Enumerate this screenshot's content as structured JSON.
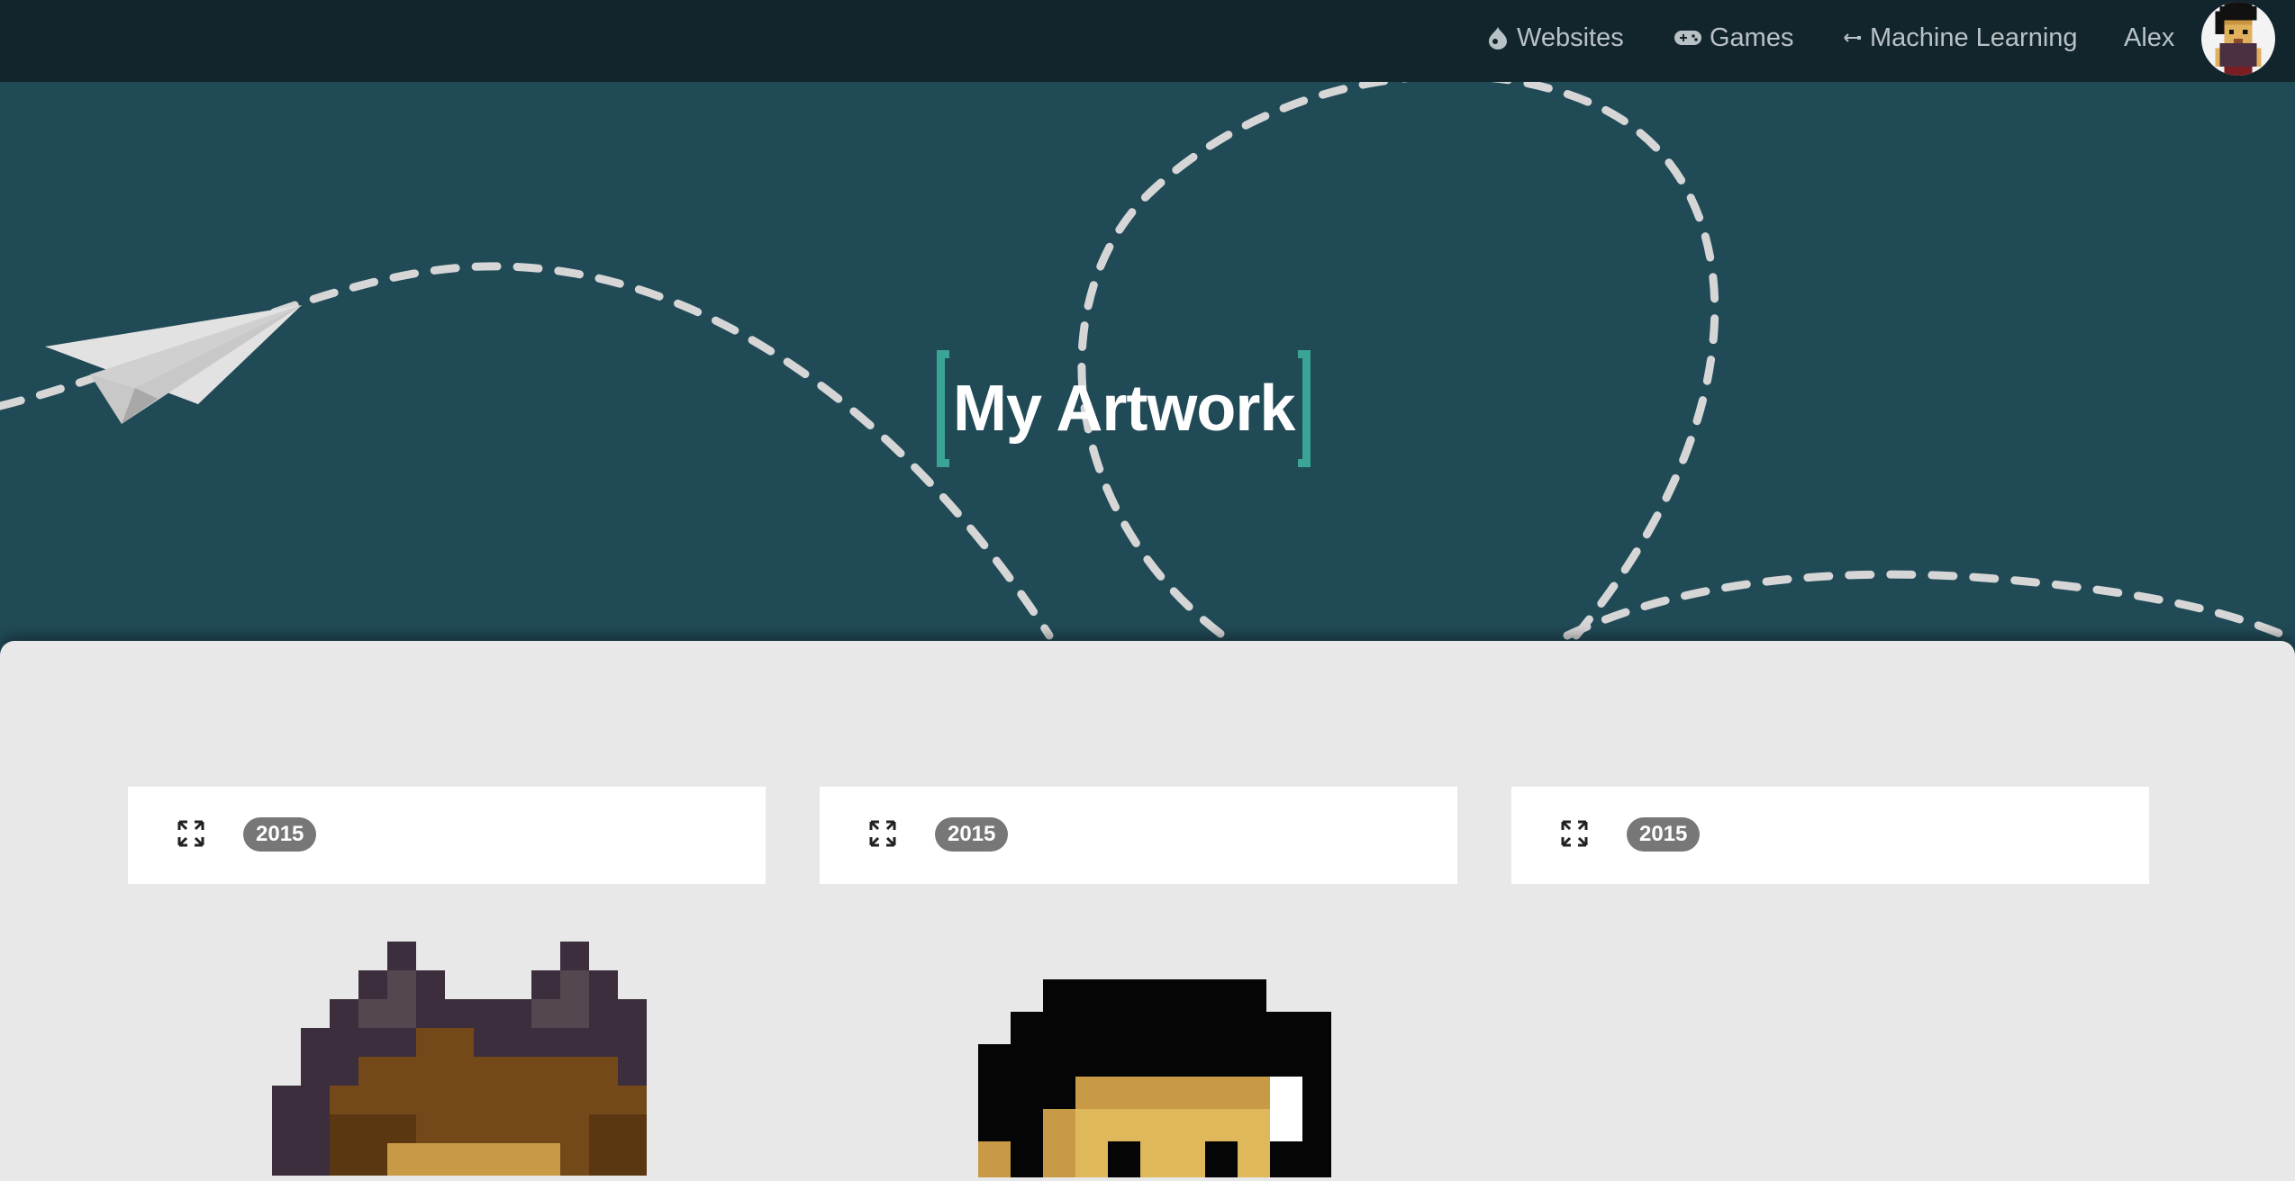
{
  "nav": {
    "items": [
      {
        "label": "Websites",
        "icon": "drupal-drop-icon"
      },
      {
        "label": "Games",
        "icon": "gamepad-icon"
      },
      {
        "label": "Machine Learning",
        "icon": "arrows-icon"
      }
    ],
    "user_name": "Alex"
  },
  "hero": {
    "title": "My Artwork"
  },
  "cards": [
    {
      "year": "2015"
    },
    {
      "year": "2015"
    },
    {
      "year": "2015"
    }
  ],
  "colors": {
    "nav_bg": "#13252c",
    "hero_bg": "#214a57",
    "accent": "#3aa597",
    "content_bg": "#e8e8e8",
    "badge_bg": "#777777"
  }
}
